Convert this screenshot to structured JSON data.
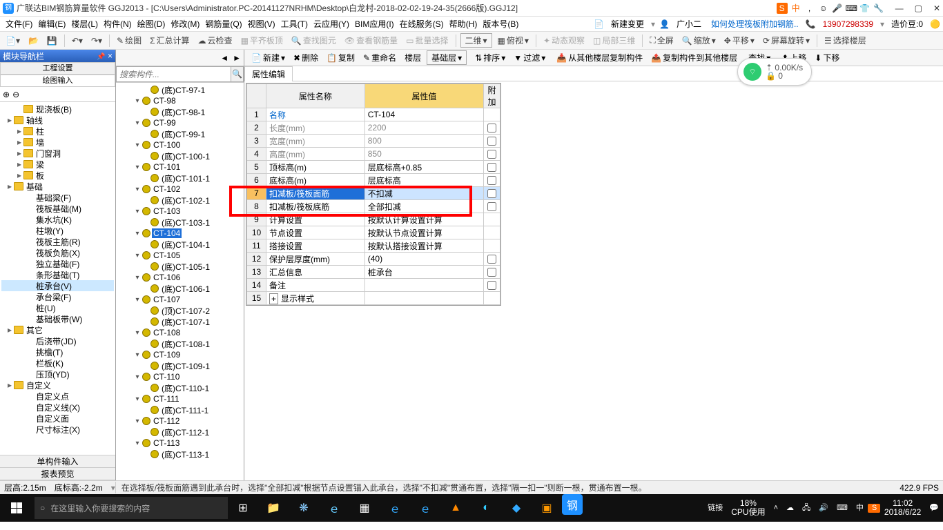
{
  "title": "广联达BIM钢筋算量软件 GGJ2013 - [C:\\Users\\Administrator.PC-20141127NRHM\\Desktop\\白龙村-2018-02-02-19-24-35(2666版).GGJ12]",
  "tray_text": "中",
  "menus": [
    "文件(F)",
    "编辑(E)",
    "楼层(L)",
    "构件(N)",
    "绘图(D)",
    "修改(M)",
    "钢筋量(Q)",
    "视图(V)",
    "工具(T)",
    "云应用(Y)",
    "BIM应用(I)",
    "在线服务(S)",
    "帮助(H)",
    "版本号(B)"
  ],
  "menu_right": {
    "new": "新建变更",
    "user": "广小二",
    "help": "如何处理筏板附加钢筋..",
    "phone": "13907298339",
    "cost": "造价豆:0"
  },
  "tb1": {
    "draw": "绘图",
    "sum": "汇总计算",
    "cloud": "云检查",
    "flat": "平齐板顶",
    "find": "查找图元",
    "viewsteel": "查看钢筋量",
    "batch": "批量选择",
    "dim": "二维",
    "fushi": "俯视",
    "dyn": "动态观察",
    "local3d": "局部三维",
    "full": "全屏",
    "zoom": "缩放",
    "pan": "平移",
    "rot": "屏幕旋转",
    "sel": "选择楼层"
  },
  "tb2": {
    "new": "新建",
    "del": "删除",
    "copy": "复制",
    "rename": "重命名",
    "floor": "楼层",
    "base": "基础层",
    "sort": "排序",
    "filter": "过滤",
    "copyfrom": "从其他楼层复制构件",
    "copyto": "复制构件到其他楼层",
    "find": "查找",
    "up": "上移",
    "down": "下移"
  },
  "net": {
    "speed": "0.00K/s",
    "count": "0"
  },
  "leftpanel": {
    "title": "模块导航栏",
    "tab1": "工程设置",
    "tab2": "绘图输入"
  },
  "tree": [
    "现浇板(B)",
    "轴线",
    "柱",
    "墙",
    "门窗洞",
    "梁",
    "板",
    "基础",
    "基础梁(F)",
    "筏板基础(M)",
    "集水坑(K)",
    "柱墩(Y)",
    "筏板主筋(R)",
    "筏板负筋(X)",
    "独立基础(F)",
    "条形基础(T)",
    "桩承台(V)",
    "承台梁(F)",
    "桩(U)",
    "基础板带(W)",
    "其它",
    "后浇带(JD)",
    "挑檐(T)",
    "栏板(K)",
    "压顶(YD)",
    "自定义",
    "自定义点",
    "自定义线(X)",
    "自定义面",
    "尺寸标注(X)"
  ],
  "btabs": [
    "单构件输入",
    "报表预览"
  ],
  "search_ph": "搜索构件...",
  "midtree": [
    {
      "l": "(底)CT-97-1",
      "i": 3
    },
    {
      "l": "CT-98",
      "i": 2,
      "t": 1
    },
    {
      "l": "(底)CT-98-1",
      "i": 3
    },
    {
      "l": "CT-99",
      "i": 2,
      "t": 1
    },
    {
      "l": "(底)CT-99-1",
      "i": 3
    },
    {
      "l": "CT-100",
      "i": 2,
      "t": 1
    },
    {
      "l": "(底)CT-100-1",
      "i": 3
    },
    {
      "l": "CT-101",
      "i": 2,
      "t": 1
    },
    {
      "l": "(底)CT-101-1",
      "i": 3
    },
    {
      "l": "CT-102",
      "i": 2,
      "t": 1
    },
    {
      "l": "(底)CT-102-1",
      "i": 3
    },
    {
      "l": "CT-103",
      "i": 2,
      "t": 1
    },
    {
      "l": "(底)CT-103-1",
      "i": 3
    },
    {
      "l": "CT-104",
      "i": 2,
      "t": 1,
      "sel": 1
    },
    {
      "l": "(底)CT-104-1",
      "i": 3
    },
    {
      "l": "CT-105",
      "i": 2,
      "t": 1
    },
    {
      "l": "(底)CT-105-1",
      "i": 3
    },
    {
      "l": "CT-106",
      "i": 2,
      "t": 1
    },
    {
      "l": "(底)CT-106-1",
      "i": 3
    },
    {
      "l": "CT-107",
      "i": 2,
      "t": 1
    },
    {
      "l": "(顶)CT-107-2",
      "i": 3
    },
    {
      "l": "(底)CT-107-1",
      "i": 3
    },
    {
      "l": "CT-108",
      "i": 2,
      "t": 1
    },
    {
      "l": "(底)CT-108-1",
      "i": 3
    },
    {
      "l": "CT-109",
      "i": 2,
      "t": 1
    },
    {
      "l": "(底)CT-109-1",
      "i": 3
    },
    {
      "l": "CT-110",
      "i": 2,
      "t": 1
    },
    {
      "l": "(底)CT-110-1",
      "i": 3
    },
    {
      "l": "CT-111",
      "i": 2,
      "t": 1
    },
    {
      "l": "(底)CT-111-1",
      "i": 3
    },
    {
      "l": "CT-112",
      "i": 2,
      "t": 1
    },
    {
      "l": "(底)CT-112-1",
      "i": 3
    },
    {
      "l": "CT-113",
      "i": 2,
      "t": 1
    },
    {
      "l": "(底)CT-113-1",
      "i": 3
    }
  ],
  "proptab": "属性编辑",
  "propheaders": {
    "name": "属性名称",
    "val": "属性值",
    "add": "附加"
  },
  "proprows": [
    {
      "n": "1",
      "name": "名称",
      "val": "CT-104",
      "link": 1
    },
    {
      "n": "2",
      "name": "长度(mm)",
      "val": "2200",
      "g": 1,
      "chk": 1
    },
    {
      "n": "3",
      "name": "宽度(mm)",
      "val": "800",
      "g": 1,
      "chk": 1
    },
    {
      "n": "4",
      "name": "高度(mm)",
      "val": "850",
      "g": 1,
      "chk": 1
    },
    {
      "n": "5",
      "name": "顶标高(m)",
      "val": "层底标高+0.85",
      "chk": 1
    },
    {
      "n": "6",
      "name": "底标高(m)",
      "val": "层底标高",
      "chk": 1
    },
    {
      "n": "7",
      "name": "扣减板/筏板面筋",
      "val": "不扣减",
      "hl": 1,
      "sel": 1,
      "chk": 1
    },
    {
      "n": "8",
      "name": "扣减板/筏板底筋",
      "val": "全部扣减",
      "chk": 1
    },
    {
      "n": "9",
      "name": "计算设置",
      "val": "按默认计算设置计算"
    },
    {
      "n": "10",
      "name": "节点设置",
      "val": "按默认节点设置计算"
    },
    {
      "n": "11",
      "name": "搭接设置",
      "val": "按默认搭接设置计算"
    },
    {
      "n": "12",
      "name": "保护层厚度(mm)",
      "val": "(40)",
      "chk": 1
    },
    {
      "n": "13",
      "name": "汇总信息",
      "val": "桩承台",
      "chk": 1
    },
    {
      "n": "14",
      "name": "备注",
      "val": "",
      "chk": 1
    },
    {
      "n": "15",
      "name": "显示样式",
      "val": "",
      "exp": 1
    }
  ],
  "status": {
    "h": "层高:2.15m",
    "bh": "底标高:-2.2m",
    "msg": "在选择板/筏板面筋遇到此承台时，选择\"全部扣减\"根据节点设置锚入此承台，选择\"不扣减\"贯通布置，选择\"隔一扣一\"则断一根，贯通布置一根。",
    "fps": "422.9 FPS"
  },
  "taskbar": {
    "search": "在这里输入你要搜索的内容",
    "link": "链接",
    "cpu_pct": "18%",
    "cpu": "CPU使用",
    "ime": "中",
    "time": "11:02",
    "date": "2018/6/22"
  }
}
